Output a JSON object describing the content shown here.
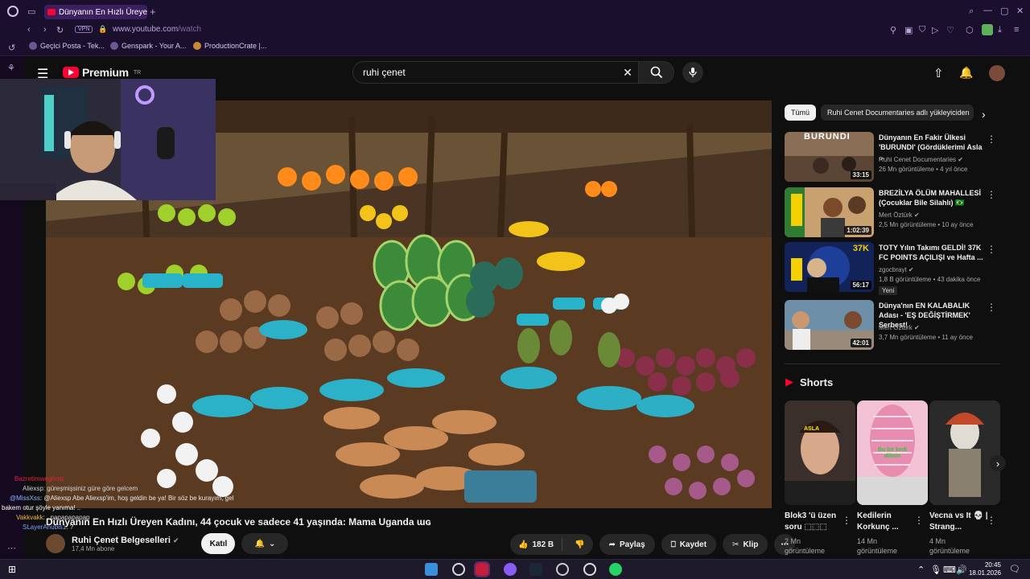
{
  "browser": {
    "tab_title": "Dünyanın En Hızlı Üreyen",
    "url_host": "www.youtube.com",
    "url_path": "/watch",
    "vpn_label": "VPN",
    "bookmarks": [
      "Geçici Posta - Tek...",
      "Genspark - Your A...",
      "ProductionCrate |..."
    ]
  },
  "youtube": {
    "logo_text": "Premium",
    "logo_badge": "TR",
    "search_value": "ruhi çenet"
  },
  "video": {
    "title": "Dünyanın En Hızlı Üreyen Kadını, 44 çocuk ve sadece 41 yaşında: Mama Uganda ɯɢ",
    "channel": "Ruhi Çenet Belgeselleri",
    "subscribers": "17,4 Mn abone",
    "join_label": "Katıl",
    "likes": "182 B",
    "share_label": "Paylaş",
    "save_label": "Kaydet",
    "clip_label": "Klip"
  },
  "chat": [
    {
      "user": "Bazretimweghost",
      "msg": "",
      "color": "#e0233f"
    },
    {
      "user": "Aliexsp",
      "msg": ": güreşmişsiniz güre göre gelcem",
      "color": "#cfcfcf"
    },
    {
      "user": "@MissXss",
      "msg": ": @Aliexsp Abe Aliexsp'im, hoş geldin be ya! Bir söz be kurayım, gel",
      "color": "#8fb8ff"
    },
    {
      "user": "",
      "msg": "bakem otur şöyle yanıma! ..",
      "color": "#ffffff"
    },
    {
      "user": "Vakkvakk",
      "msg": ": ..papapapapap",
      "color": "#f5b83d"
    },
    {
      "user": "SLayerAnubis1",
      "msg": ": ?",
      "color": "#7aa0ff"
    }
  ],
  "chips": [
    "Tümü",
    "Ruhi Cenet Documentaries adlı yükleyiciden"
  ],
  "recommendations": [
    {
      "title": "Dünyanın En Fakir Ülkesi 'BURUNDI' (Gördüklerimi Asla ...",
      "channel": "Ruhi Cenet Documentaries",
      "meta": "26 Mn görüntüleme • 4 yıl önce",
      "duration": "33:15",
      "thumb_text": "BURUNDI"
    },
    {
      "title": "BREZİLYA ÖLÜM MAHALLESİ (Çocuklar Bile Silahlı) 🇧🇷",
      "channel": "Mert Öztürk",
      "meta": "2,5 Mn görüntüleme • 10 ay önce",
      "duration": "1:02:39",
      "thumb_text": ""
    },
    {
      "title": "TOTY Yılın Takımı GELDİ! 37K FC POINTS AÇILIŞI ve Hafta ...",
      "channel": "zgocbrayt",
      "meta": "1,8 B görüntüleme • 43 dakika önce",
      "duration": "56:17",
      "thumb_text": "37K",
      "badge": "Yeni"
    },
    {
      "title": "Dünya'nın EN KALABALIK Adası - 'EŞ DEĞİŞTİRMEK' Serbest!",
      "channel": "Mert Öztürk",
      "meta": "3,7 Mn görüntüleme • 11 ay önce",
      "duration": "42:01",
      "thumb_text": ""
    }
  ],
  "shorts": {
    "heading": "Shorts",
    "items": [
      {
        "title": "Blok3 'ü üzen soru ⬚⬚⬚",
        "views": "2 Mn görüntüleme",
        "label": "ASLA"
      },
      {
        "title": "Kedilerin Korkunç ...",
        "views": "14 Mn görüntüleme",
        "label": "Bu bir kedi dilinin"
      },
      {
        "title": "Vecna vs It 💀 | Strang...",
        "views": "4 Mn görüntüleme",
        "label": ""
      }
    ]
  },
  "taskbar": {
    "time": "20:45",
    "date": "18.01.2026"
  }
}
